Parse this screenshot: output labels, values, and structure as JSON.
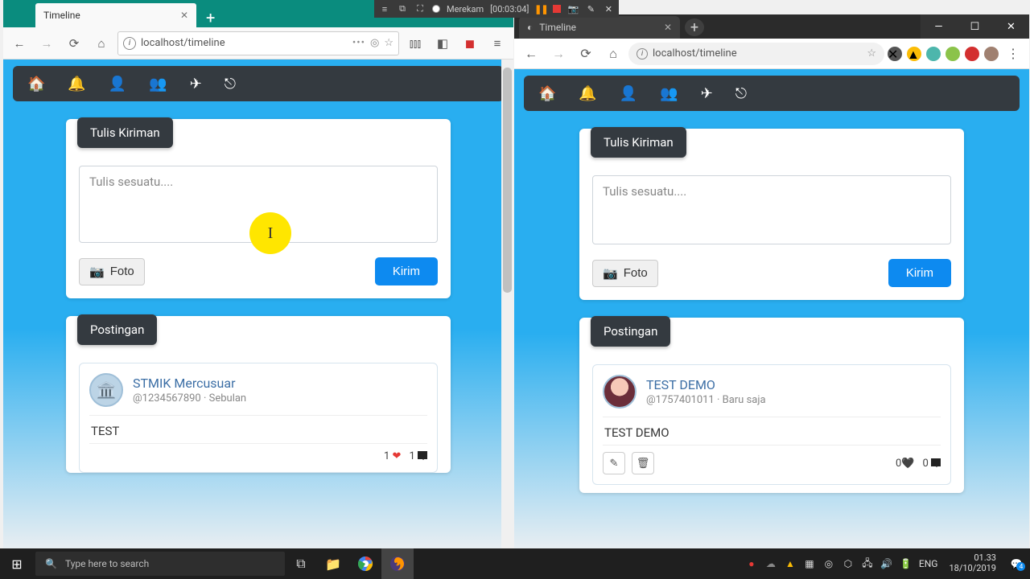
{
  "recorder": {
    "label": "Merekam",
    "elapsed": "[00:03:04]"
  },
  "firefox": {
    "tab_title": "Timeline",
    "url": "localhost/timeline",
    "compose_badge": "Tulis Kiriman",
    "compose_placeholder": "Tulis sesuatu....",
    "foto_label": "Foto",
    "kirim_label": "Kirim",
    "posts_badge": "Postingan",
    "post": {
      "name": "STMIK Mercusuar",
      "handle": "@1234567890",
      "sep": " · ",
      "time": "Sebulan",
      "body": "TEST",
      "likes": "1",
      "comments": "1"
    }
  },
  "chrome": {
    "tab_title": "Timeline",
    "url": "localhost/timeline",
    "compose_badge": "Tulis Kiriman",
    "compose_placeholder": "Tulis sesuatu....",
    "foto_label": "Foto",
    "kirim_label": "Kirim",
    "posts_badge": "Postingan",
    "post": {
      "name": "TEST DEMO",
      "handle": "@1757401011",
      "sep": " · ",
      "time": "Baru saja",
      "body": "TEST DEMO",
      "likes": "0",
      "comments": "0"
    }
  },
  "taskbar": {
    "search_placeholder": "Type here to search",
    "lang": "ENG",
    "time": "01.33",
    "date": "18/10/2019",
    "notif_count": "4"
  }
}
